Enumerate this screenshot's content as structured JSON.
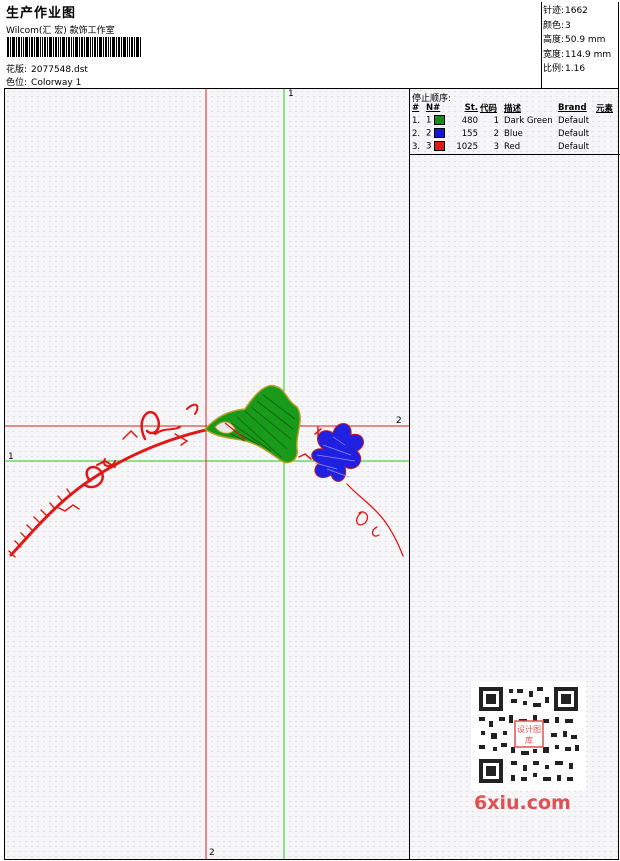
{
  "header": {
    "title": "生产作业图",
    "subtitle": "Wilcom(汇 宏) 款饰工作室",
    "design_label": "花版:",
    "design_value": "2077548.dst",
    "colorway_label": "色位:",
    "colorway_value": "Colorway 1"
  },
  "stats": {
    "stitches_label": "针迹:",
    "stitches_value": "1662",
    "colors_label": "颜色:",
    "colors_value": "3",
    "height_label": "高度:",
    "height_value": "50.9 mm",
    "width_label": "宽度:",
    "width_value": "114.9 mm",
    "scale_label": "比例:",
    "scale_value": "1.16"
  },
  "stop_sequence": {
    "title": "停止顺序:",
    "headers": {
      "num": "#",
      "n": "N#",
      "st": "St.",
      "code": "代码",
      "desc": "描述",
      "brand": "Brand",
      "element": "元素"
    },
    "rows": [
      {
        "num": "1.",
        "n": "1",
        "color": "#1a8a1a",
        "st": "480",
        "code": "1",
        "desc": "Dark Green",
        "brand": "Default"
      },
      {
        "num": "2.",
        "n": "2",
        "color": "#1515d0",
        "st": "155",
        "code": "2",
        "desc": "Blue",
        "brand": "Default"
      },
      {
        "num": "3.",
        "n": "3",
        "color": "#e01818",
        "st": "1025",
        "code": "3",
        "desc": "Red",
        "brand": "Default"
      }
    ]
  },
  "axes": {
    "green_vertical_label": "1",
    "green_horizontal_label": "1",
    "red_horizontal_label": "2",
    "red_vertical_label": "2"
  },
  "watermark": {
    "text": "6xiu.com",
    "qr_text": "设计图库"
  }
}
